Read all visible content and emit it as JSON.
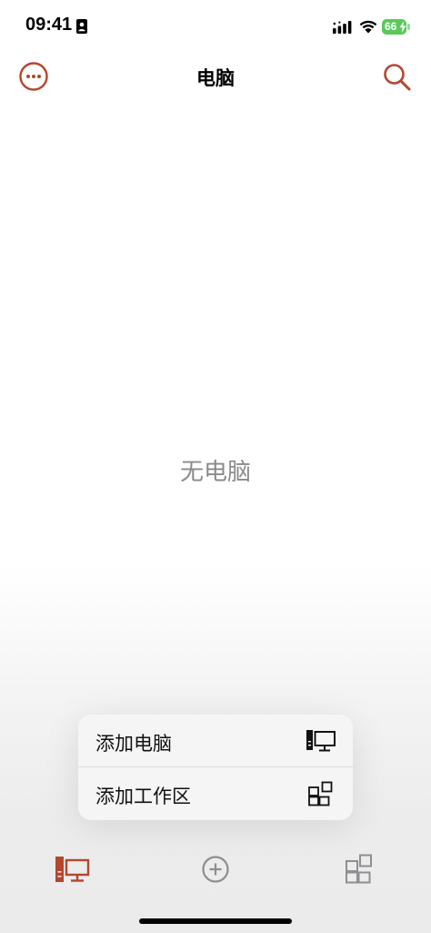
{
  "status_bar": {
    "time": "09:41",
    "battery_level": "66",
    "icons": [
      "person-badge-icon",
      "signal-icon",
      "wifi-icon",
      "battery-charging-icon"
    ]
  },
  "nav_bar": {
    "title": "电脑",
    "left_icon": "ellipsis-circle-icon",
    "right_icon": "search-icon"
  },
  "main": {
    "empty_message": "无电脑"
  },
  "popup_menu": {
    "items": [
      {
        "label": "添加电脑",
        "icon": "desktop-computer-icon"
      },
      {
        "label": "添加工作区",
        "icon": "workspace-grid-icon"
      }
    ]
  },
  "tab_bar": {
    "tabs": [
      {
        "icon": "computers-tab-icon",
        "selected": true
      },
      {
        "icon": "add-circle-icon",
        "selected": false
      },
      {
        "icon": "workspaces-tab-icon",
        "selected": false
      }
    ]
  },
  "colors": {
    "accent": "#b5462e",
    "secondary_icon": "#8e8e93",
    "empty_text": "#8a8a8a",
    "battery": "#5ac85a"
  }
}
